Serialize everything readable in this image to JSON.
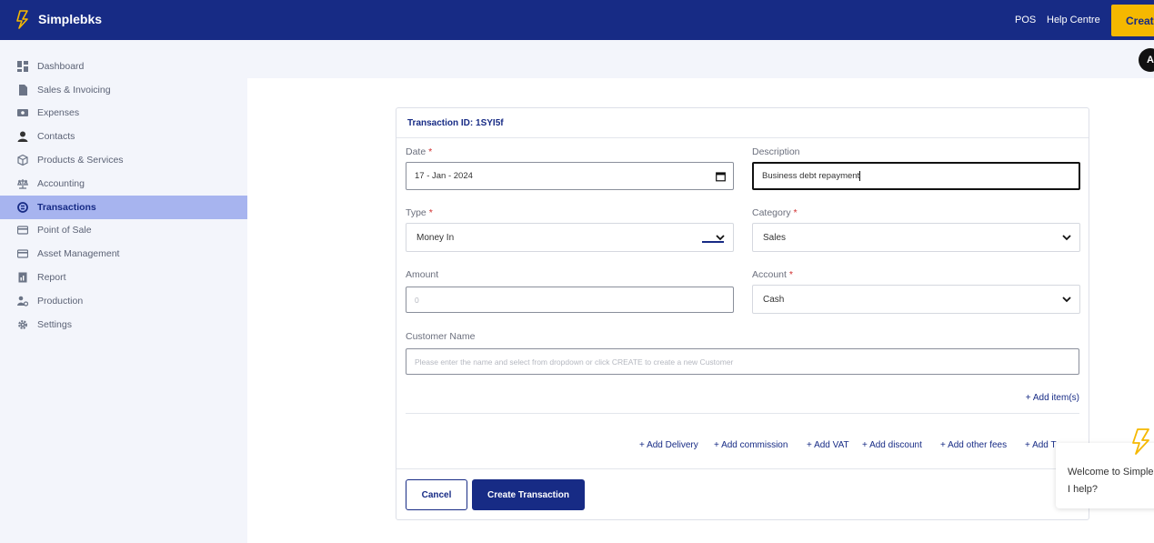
{
  "header": {
    "brand": "Simplebks",
    "links": {
      "pos": "POS",
      "help": "Help Centre"
    },
    "create_label": "Creat",
    "avatar_initial": "A"
  },
  "sidebar": {
    "items": [
      {
        "label": "Dashboard",
        "icon": "dashboard-icon"
      },
      {
        "label": "Sales & Invoicing",
        "icon": "document-icon"
      },
      {
        "label": "Expenses",
        "icon": "wallet-icon"
      },
      {
        "label": "Contacts",
        "icon": "user-icon"
      },
      {
        "label": "Products & Services",
        "icon": "box-icon"
      },
      {
        "label": "Accounting",
        "icon": "scale-icon"
      },
      {
        "label": "Transactions",
        "icon": "transactions-icon",
        "active": true
      },
      {
        "label": "Point of Sale",
        "icon": "card-icon"
      },
      {
        "label": "Asset Management",
        "icon": "card-icon"
      },
      {
        "label": "Report",
        "icon": "report-icon"
      },
      {
        "label": "Production",
        "icon": "production-icon"
      },
      {
        "label": "Settings",
        "icon": "gear-icon"
      }
    ]
  },
  "form": {
    "transaction_id": "Transaction ID: 1SYI5f",
    "date": {
      "label": "Date",
      "required_mark": "*",
      "value": "17 - Jan - 2024"
    },
    "description": {
      "label": "Description",
      "value": "Business debt repayment"
    },
    "type": {
      "label": "Type",
      "required_mark": "*",
      "value": "Money In"
    },
    "category": {
      "label": "Category",
      "required_mark": "*",
      "value": "Sales"
    },
    "amount": {
      "label": "Amount",
      "placeholder": "0"
    },
    "account": {
      "label": "Account",
      "required_mark": "*",
      "value": "Cash"
    },
    "customer": {
      "label": "Customer Name",
      "placeholder": "Please enter the name and select from dropdown or click CREATE to create a new Customer"
    },
    "add_items": "+ Add item(s)",
    "extras": [
      "+ Add Delivery",
      "+ Add commission",
      "+ Add VAT",
      "+ Add discount",
      "+ Add other fees",
      "+ Add T"
    ],
    "cancel": "Cancel",
    "create": "Create Transaction"
  },
  "chat": {
    "line1": "Welcome to Simple",
    "line2": "I help?"
  },
  "colors": {
    "header_bg": "#172b85",
    "accent": "#f5b800",
    "active_bg": "#a7b4ef"
  }
}
